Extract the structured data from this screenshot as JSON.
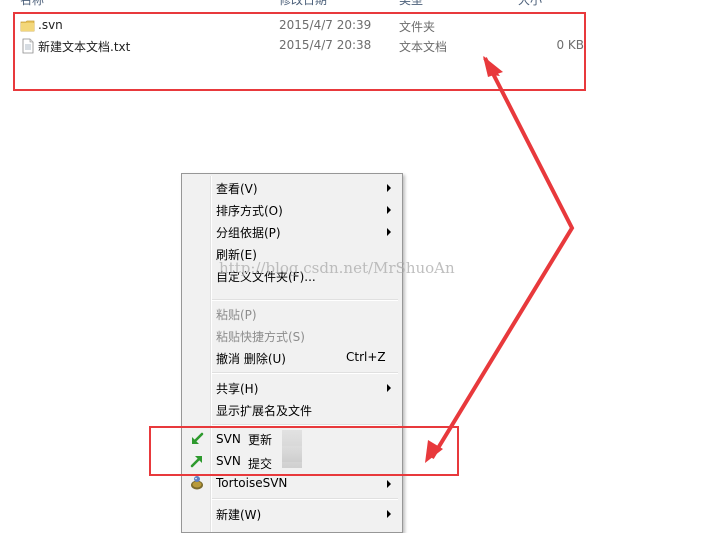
{
  "columns": {
    "name": "名称",
    "date": "修改日期",
    "type": "类型",
    "size": "大小"
  },
  "files": [
    {
      "name": ".svn",
      "date": "2015/4/7 20:39",
      "type": "文件夹",
      "size": "",
      "icon": "folder-icon"
    },
    {
      "name": "新建文本文档.txt",
      "date": "2015/4/7 20:38",
      "type": "文本文档",
      "size": "0 KB",
      "icon": "text-file-icon"
    }
  ],
  "menu": {
    "group1": [
      {
        "label": "查看(V)",
        "submenu": true
      },
      {
        "label": "排序方式(O)",
        "submenu": true
      },
      {
        "label": "分组依据(P)",
        "submenu": true
      },
      {
        "label": "刷新(E)",
        "submenu": false
      },
      {
        "label": "自定义文件夹(F)...",
        "submenu": false
      }
    ],
    "group2": [
      {
        "label": "粘贴(P)",
        "disabled": true
      },
      {
        "label": "粘贴快捷方式(S)",
        "disabled": true
      },
      {
        "label": "撤消 删除(U)",
        "shortcut": "Ctrl+Z"
      }
    ],
    "group3": [
      {
        "label": "共享(H)",
        "submenu": true
      },
      {
        "label": "显示扩展名及文件",
        "submenu": false
      }
    ],
    "group4": [
      {
        "label": "SVN",
        "annotation": "更新",
        "icon": "svn-update-icon"
      },
      {
        "label": "SVN",
        "annotation": "提交",
        "icon": "svn-commit-icon"
      },
      {
        "label": "TortoiseSVN",
        "submenu": true,
        "icon": "tortoisesvn-icon"
      }
    ],
    "group5": [
      {
        "label": "新建(W)",
        "submenu": true
      }
    ]
  },
  "watermark": "http://blog.csdn.net/MrShuoAn",
  "colors": {
    "annotation_red": "#e8393c",
    "menu_bg": "#f1f1f1",
    "folder_yellow": "#e8c45a"
  }
}
